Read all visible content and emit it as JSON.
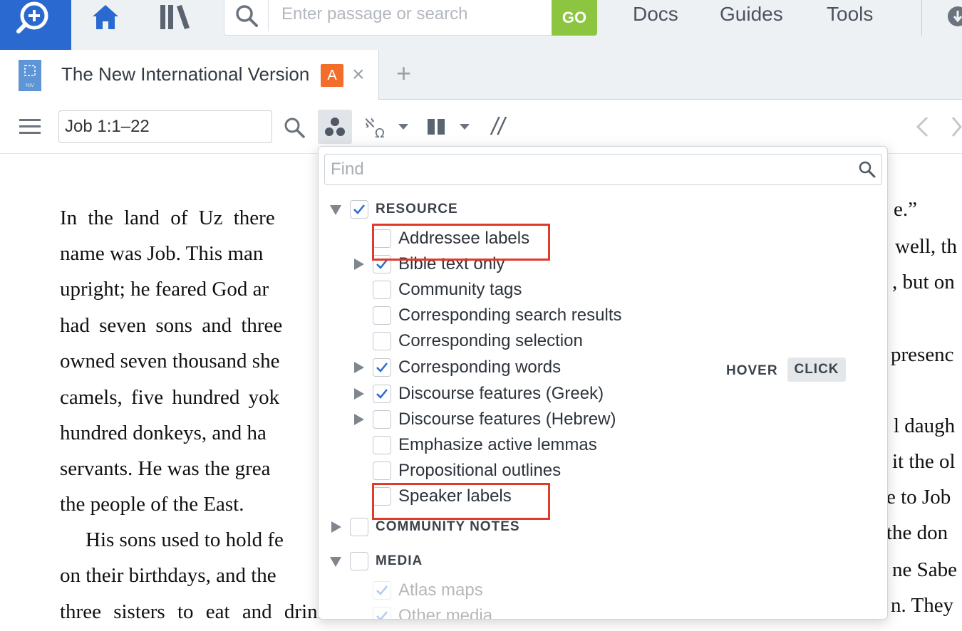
{
  "topbar": {
    "search_placeholder": "Enter passage or search",
    "go_label": "GO",
    "nav": [
      "Docs",
      "Guides",
      "Tools"
    ]
  },
  "tab": {
    "title": "The New International Version",
    "badge": "A",
    "thumb_label": "NIV",
    "close": "×",
    "add": "+"
  },
  "toolbar": {
    "reference": "Job 1:1–22",
    "parallel_symbol": "//"
  },
  "reading": {
    "left_lines": [
      "In the land of Uz there",
      "name was Job. This man",
      "upright; he feared God ar",
      "had seven sons and three",
      "owned seven thousand she",
      "camels, five hundred yok",
      "hundred donkeys, and ha",
      "servants. He was the grea",
      "the people of the East.",
      "His sons used to hold fe",
      "on their birthdays, and the",
      "three sisters to eat and drink with them."
    ],
    "right_lines": [
      "e.”",
      "well, th",
      ", but on",
      "",
      "presenc",
      "",
      "l daugh",
      "it the ol",
      "e to Job",
      "the don",
      "ne  Sabe",
      "n. They"
    ]
  },
  "panel": {
    "find_placeholder": "Find",
    "sections": {
      "resource": "RESOURCE",
      "community_notes": "COMMUNITY NOTES",
      "media": "MEDIA"
    },
    "items": [
      {
        "label": "Addressee labels",
        "checked": false,
        "expandable": false
      },
      {
        "label": "Bible text only",
        "checked": true,
        "expandable": true
      },
      {
        "label": "Community tags",
        "checked": false,
        "expandable": false
      },
      {
        "label": "Corresponding search results",
        "checked": false,
        "expandable": false
      },
      {
        "label": "Corresponding selection",
        "checked": false,
        "expandable": false
      },
      {
        "label": "Corresponding words",
        "checked": true,
        "expandable": true
      },
      {
        "label": "Discourse features (Greek)",
        "checked": true,
        "expandable": true
      },
      {
        "label": "Discourse features (Hebrew)",
        "checked": false,
        "expandable": true
      },
      {
        "label": "Emphasize active lemmas",
        "checked": false,
        "expandable": false
      },
      {
        "label": "Propositional outlines",
        "checked": false,
        "expandable": false
      },
      {
        "label": "Speaker labels",
        "checked": false,
        "expandable": false
      }
    ],
    "media_items": [
      {
        "label": "Atlas maps",
        "checked": true
      },
      {
        "label": "Other media",
        "checked": true
      }
    ],
    "hover_label": "HOVER",
    "click_label": "CLICK"
  },
  "colors": {
    "accent_blue": "#2a6ad0",
    "go_green": "#8cc540",
    "badge_orange": "#f26e2a",
    "highlight_red": "#e03a2b",
    "check_blue": "#2a6ad0"
  }
}
